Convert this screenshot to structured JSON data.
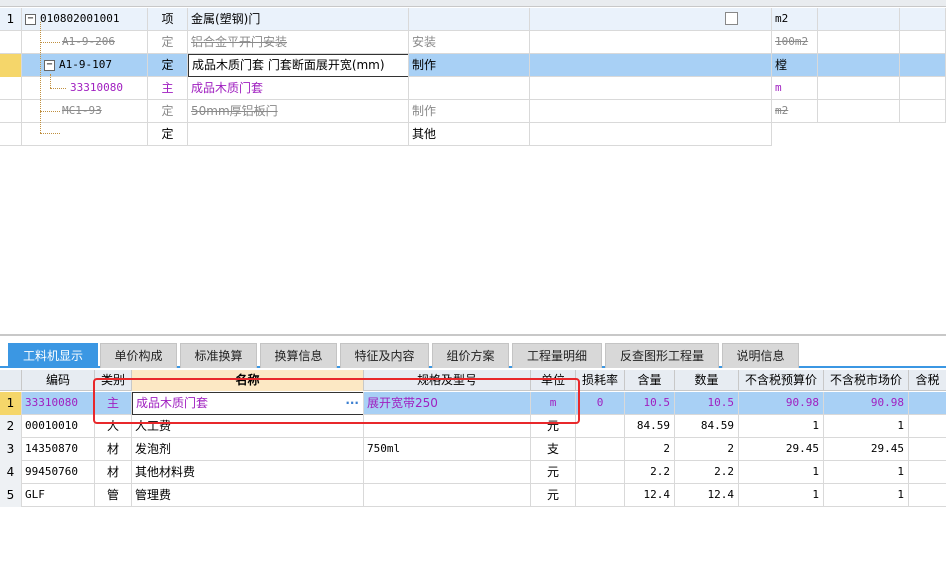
{
  "top_grid": {
    "rows": [
      {
        "num": "1",
        "code": "010802001001",
        "type": "项",
        "name": "金属(塑钢)门",
        "spec": "",
        "unit": "m2",
        "has_checkbox": true
      },
      {
        "num": "",
        "code": "A1-9-206",
        "type": "定",
        "name": "铝合金平开门安装",
        "spec": "安装",
        "unit": "100m2",
        "strike": true
      },
      {
        "num": "",
        "code": "A1-9-107",
        "type": "定",
        "name": "成品木质门套 门套断面展开宽(mm)",
        "spec": "制作",
        "unit": "樘",
        "selected": true
      },
      {
        "num": "",
        "code": "33310080",
        "type": "主",
        "name": "成品木质门套",
        "spec": "",
        "unit": "m",
        "purple": true
      },
      {
        "num": "",
        "code": "MC1-93",
        "type": "定",
        "name": "50mm厚铝板门",
        "spec": "制作",
        "unit": "m2",
        "strike": true
      },
      {
        "num": "",
        "code": "",
        "type": "定",
        "name": "",
        "spec": "其他",
        "unit": ""
      }
    ]
  },
  "tabs": [
    {
      "label": "工料机显示",
      "active": true
    },
    {
      "label": "单价构成"
    },
    {
      "label": "标准换算"
    },
    {
      "label": "换算信息"
    },
    {
      "label": "特征及内容"
    },
    {
      "label": "组价方案"
    },
    {
      "label": "工程量明细"
    },
    {
      "label": "反查图形工程量"
    },
    {
      "label": "说明信息"
    }
  ],
  "bottom_grid": {
    "columns": [
      "编码",
      "类别",
      "名称",
      "规格及型号",
      "单位",
      "损耗率",
      "含量",
      "数量",
      "不含税预算价",
      "不含税市场价",
      "含税"
    ],
    "rows": [
      {
        "num": "1",
        "code": "33310080",
        "cat": "主",
        "name": "成品木质门套",
        "spec": "展开宽带250",
        "unit": "m",
        "loss": "0",
        "content": "10.5",
        "qty": "10.5",
        "budget": "90.98",
        "market": "90.98",
        "selected": true
      },
      {
        "num": "2",
        "code": "00010010",
        "cat": "人",
        "name": "人工费",
        "spec": "",
        "unit": "元",
        "loss": "",
        "content": "84.59",
        "qty": "84.59",
        "budget": "1",
        "market": "1"
      },
      {
        "num": "3",
        "code": "14350870",
        "cat": "材",
        "name": "发泡剂",
        "spec": "750ml",
        "unit": "支",
        "loss": "",
        "content": "2",
        "qty": "2",
        "budget": "29.45",
        "market": "29.45"
      },
      {
        "num": "4",
        "code": "99450760",
        "cat": "材",
        "name": "其他材料费",
        "spec": "",
        "unit": "元",
        "loss": "",
        "content": "2.2",
        "qty": "2.2",
        "budget": "1",
        "market": "1"
      },
      {
        "num": "5",
        "code": "GLF",
        "cat": "管",
        "name": "管理费",
        "spec": "",
        "unit": "元",
        "loss": "",
        "content": "12.4",
        "qty": "12.4",
        "budget": "1",
        "market": "1"
      }
    ],
    "ellipsis": "···"
  },
  "colors": {
    "accent": "#3b97e3",
    "selected_row": "#a8d0f5",
    "highlight_box": "#e8282b",
    "main_material": "#a020c0"
  }
}
